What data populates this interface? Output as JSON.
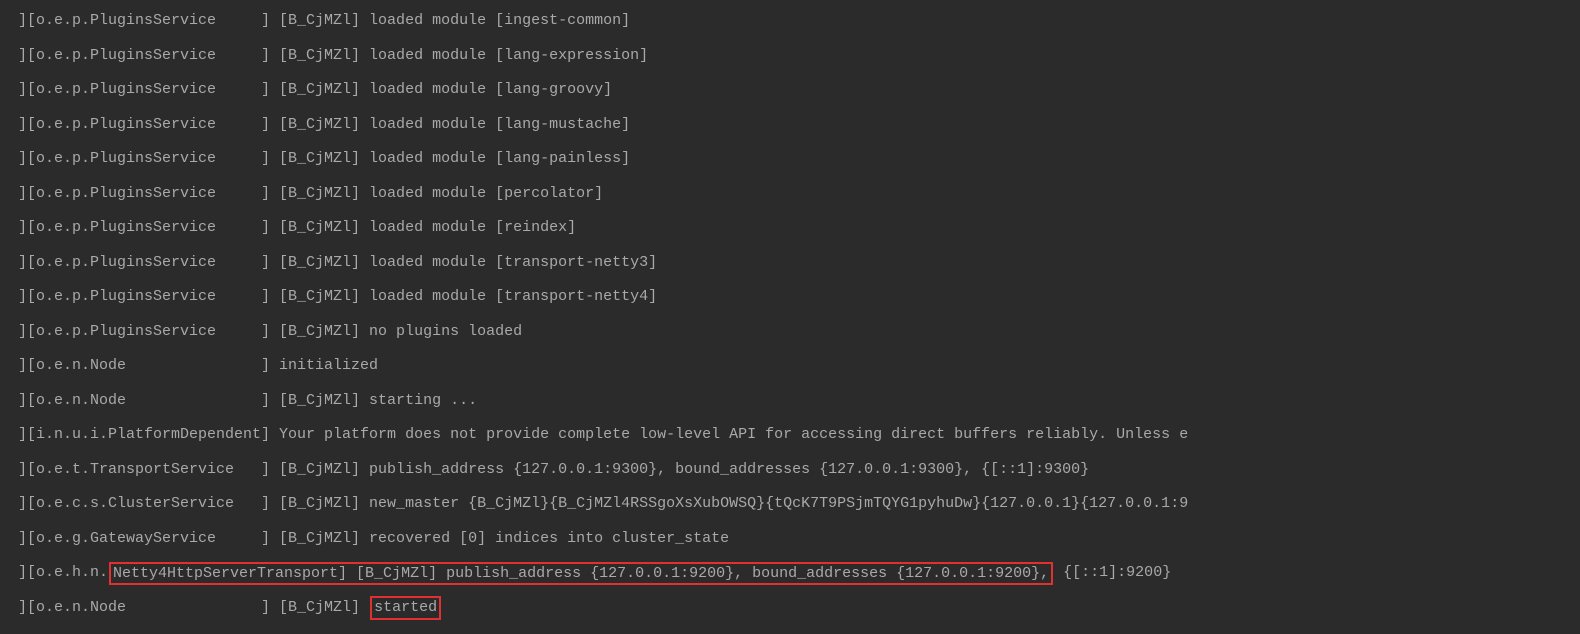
{
  "lines": [
    {
      "segments": [
        {
          "text": "][o.e.p.PluginsService     ] [B_CjMZl] loaded module [ingest-common]"
        }
      ]
    },
    {
      "segments": [
        {
          "text": "][o.e.p.PluginsService     ] [B_CjMZl] loaded module [lang-expression]"
        }
      ]
    },
    {
      "segments": [
        {
          "text": "][o.e.p.PluginsService     ] [B_CjMZl] loaded module [lang-groovy]"
        }
      ]
    },
    {
      "segments": [
        {
          "text": "][o.e.p.PluginsService     ] [B_CjMZl] loaded module [lang-mustache]"
        }
      ]
    },
    {
      "segments": [
        {
          "text": "][o.e.p.PluginsService     ] [B_CjMZl] loaded module [lang-painless]"
        }
      ]
    },
    {
      "segments": [
        {
          "text": "][o.e.p.PluginsService     ] [B_CjMZl] loaded module [percolator]"
        }
      ]
    },
    {
      "segments": [
        {
          "text": "][o.e.p.PluginsService     ] [B_CjMZl] loaded module [reindex]"
        }
      ]
    },
    {
      "segments": [
        {
          "text": "][o.e.p.PluginsService     ] [B_CjMZl] loaded module [transport-netty3]"
        }
      ]
    },
    {
      "segments": [
        {
          "text": "][o.e.p.PluginsService     ] [B_CjMZl] loaded module [transport-netty4]"
        }
      ]
    },
    {
      "segments": [
        {
          "text": "][o.e.p.PluginsService     ] [B_CjMZl] no plugins loaded"
        }
      ]
    },
    {
      "segments": [
        {
          "text": "][o.e.n.Node               ] initialized"
        }
      ]
    },
    {
      "segments": [
        {
          "text": "][o.e.n.Node               ] [B_CjMZl] starting ..."
        }
      ]
    },
    {
      "segments": [
        {
          "text": "][i.n.u.i.PlatformDependent] Your platform does not provide complete low-level API for accessing direct buffers reliably. Unless e"
        }
      ]
    },
    {
      "segments": [
        {
          "text": "][o.e.t.TransportService   ] [B_CjMZl] publish_address {127.0.0.1:9300}, bound_addresses {127.0.0.1:9300}, {[::1]:9300}"
        }
      ]
    },
    {
      "segments": [
        {
          "text": "][o.e.c.s.ClusterService   ] [B_CjMZl] new_master {B_CjMZl}{B_CjMZl4RSSgoXsXubOWSQ}{tQcK7T9PSjmTQYG1pyhuDw}{127.0.0.1}{127.0.0.1:9"
        }
      ]
    },
    {
      "segments": [
        {
          "text": "][o.e.g.GatewayService     ] [B_CjMZl] recovered [0] indices into cluster_state"
        }
      ]
    },
    {
      "segments": [
        {
          "text": "][o.e.h.n."
        },
        {
          "text": "Netty4HttpServerTransport] [B_CjMZl] publish_address {127.0.0.1:9200}, bound_addresses {127.0.0.1:9200},",
          "highlight": true
        },
        {
          "text": " {[::1]:9200}"
        }
      ]
    },
    {
      "segments": [
        {
          "text": "][o.e.n.Node               ] [B_CjMZl] "
        },
        {
          "text": "started",
          "highlight": true
        }
      ]
    }
  ]
}
